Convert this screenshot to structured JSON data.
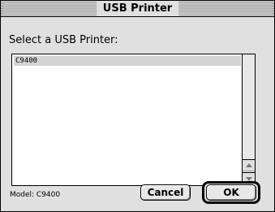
{
  "window": {
    "title": "USB Printer"
  },
  "dialog": {
    "prompt": "Select a USB Printer:",
    "printers": [
      "C9400"
    ],
    "selected_index": 0,
    "model_text": "Model: C9400"
  },
  "buttons": {
    "cancel_label": "Cancel",
    "ok_label": "OK"
  },
  "icons": {
    "scroll_up": "scroll-up-arrow-icon",
    "scroll_down": "scroll-down-arrow-icon"
  }
}
